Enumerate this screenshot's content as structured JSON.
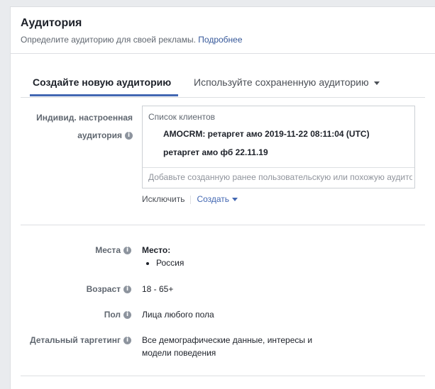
{
  "header": {
    "title": "Аудитория",
    "subtitle": "Определите аудиторию для своей рекламы.",
    "more_link": "Подробнее"
  },
  "tabs": {
    "create_new": "Создайте новую аудиторию",
    "use_saved": "Используйте сохраненную аудиторию"
  },
  "custom_audience": {
    "label_line1": "Индивид. настроенная",
    "label_line2": "аудитория",
    "box_title": "Список клиентов",
    "items": [
      "AMOCRM: ретаргет амо 2019-11-22 08:11:04 (UTC)",
      "ретаргет амо фб 22.11.19"
    ],
    "input_placeholder": "Добавьте созданную ранее пользовательскую или похожую аудитори",
    "exclude_label": "Исключить",
    "create_label": "Создать"
  },
  "locations": {
    "label": "Места",
    "title": "Место:",
    "items": [
      "Россия"
    ]
  },
  "age": {
    "label": "Возраст",
    "value": "18 - 65+"
  },
  "gender": {
    "label": "Пол",
    "value": "Лица любого пола"
  },
  "detailed_targeting": {
    "label": "Детальный таргетинг",
    "value_line1": "Все демографические данные, интересы и",
    "value_line2": "модели поведения"
  },
  "colors": {
    "accent": "#4267b2",
    "link": "#365899",
    "text": "#1d2129",
    "muted": "#606770",
    "border": "#dddfe2"
  },
  "icons": {
    "info": "info-icon",
    "dropdown": "caret-down-icon"
  }
}
